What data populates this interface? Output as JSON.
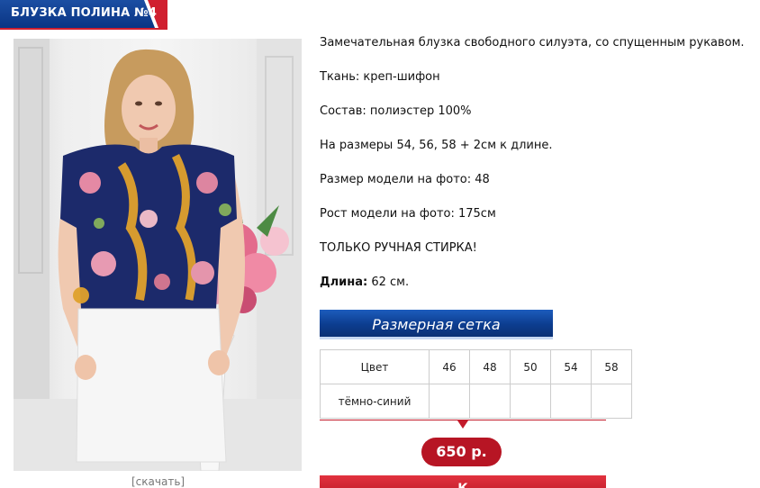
{
  "product": {
    "title": "БЛУЗКА ПОЛИНА №4",
    "download_link": "[скачать]"
  },
  "description": {
    "intro": "Замечательная блузка свободного силуэта, со спущенным рукавом.",
    "fabric": "Ткань: креп-шифон",
    "composition": "Состав: полиэстер 100%",
    "sizes": "На размеры 54, 56, 58 + 2см к длине.",
    "model_size": "Размер модели на фото: 48",
    "model_height": "Рост модели на фото: 175см",
    "care": "ТОЛЬКО РУЧНАЯ СТИРКА!",
    "length_label": "Длина:",
    "length_value": "62 см."
  },
  "size_chart": {
    "header": "Размерная сетка",
    "color_header": "Цвет",
    "sizes": [
      "46",
      "48",
      "50",
      "54",
      "58"
    ],
    "color_row": "тёмно-синий"
  },
  "price": {
    "value": "650 р."
  },
  "buy": {
    "label": "К"
  },
  "colors": {
    "brand_blue": "#0a3584",
    "brand_red": "#c31b2b",
    "blouse_navy": "#1c2a6b",
    "skirt_white": "#f4f4f4"
  }
}
